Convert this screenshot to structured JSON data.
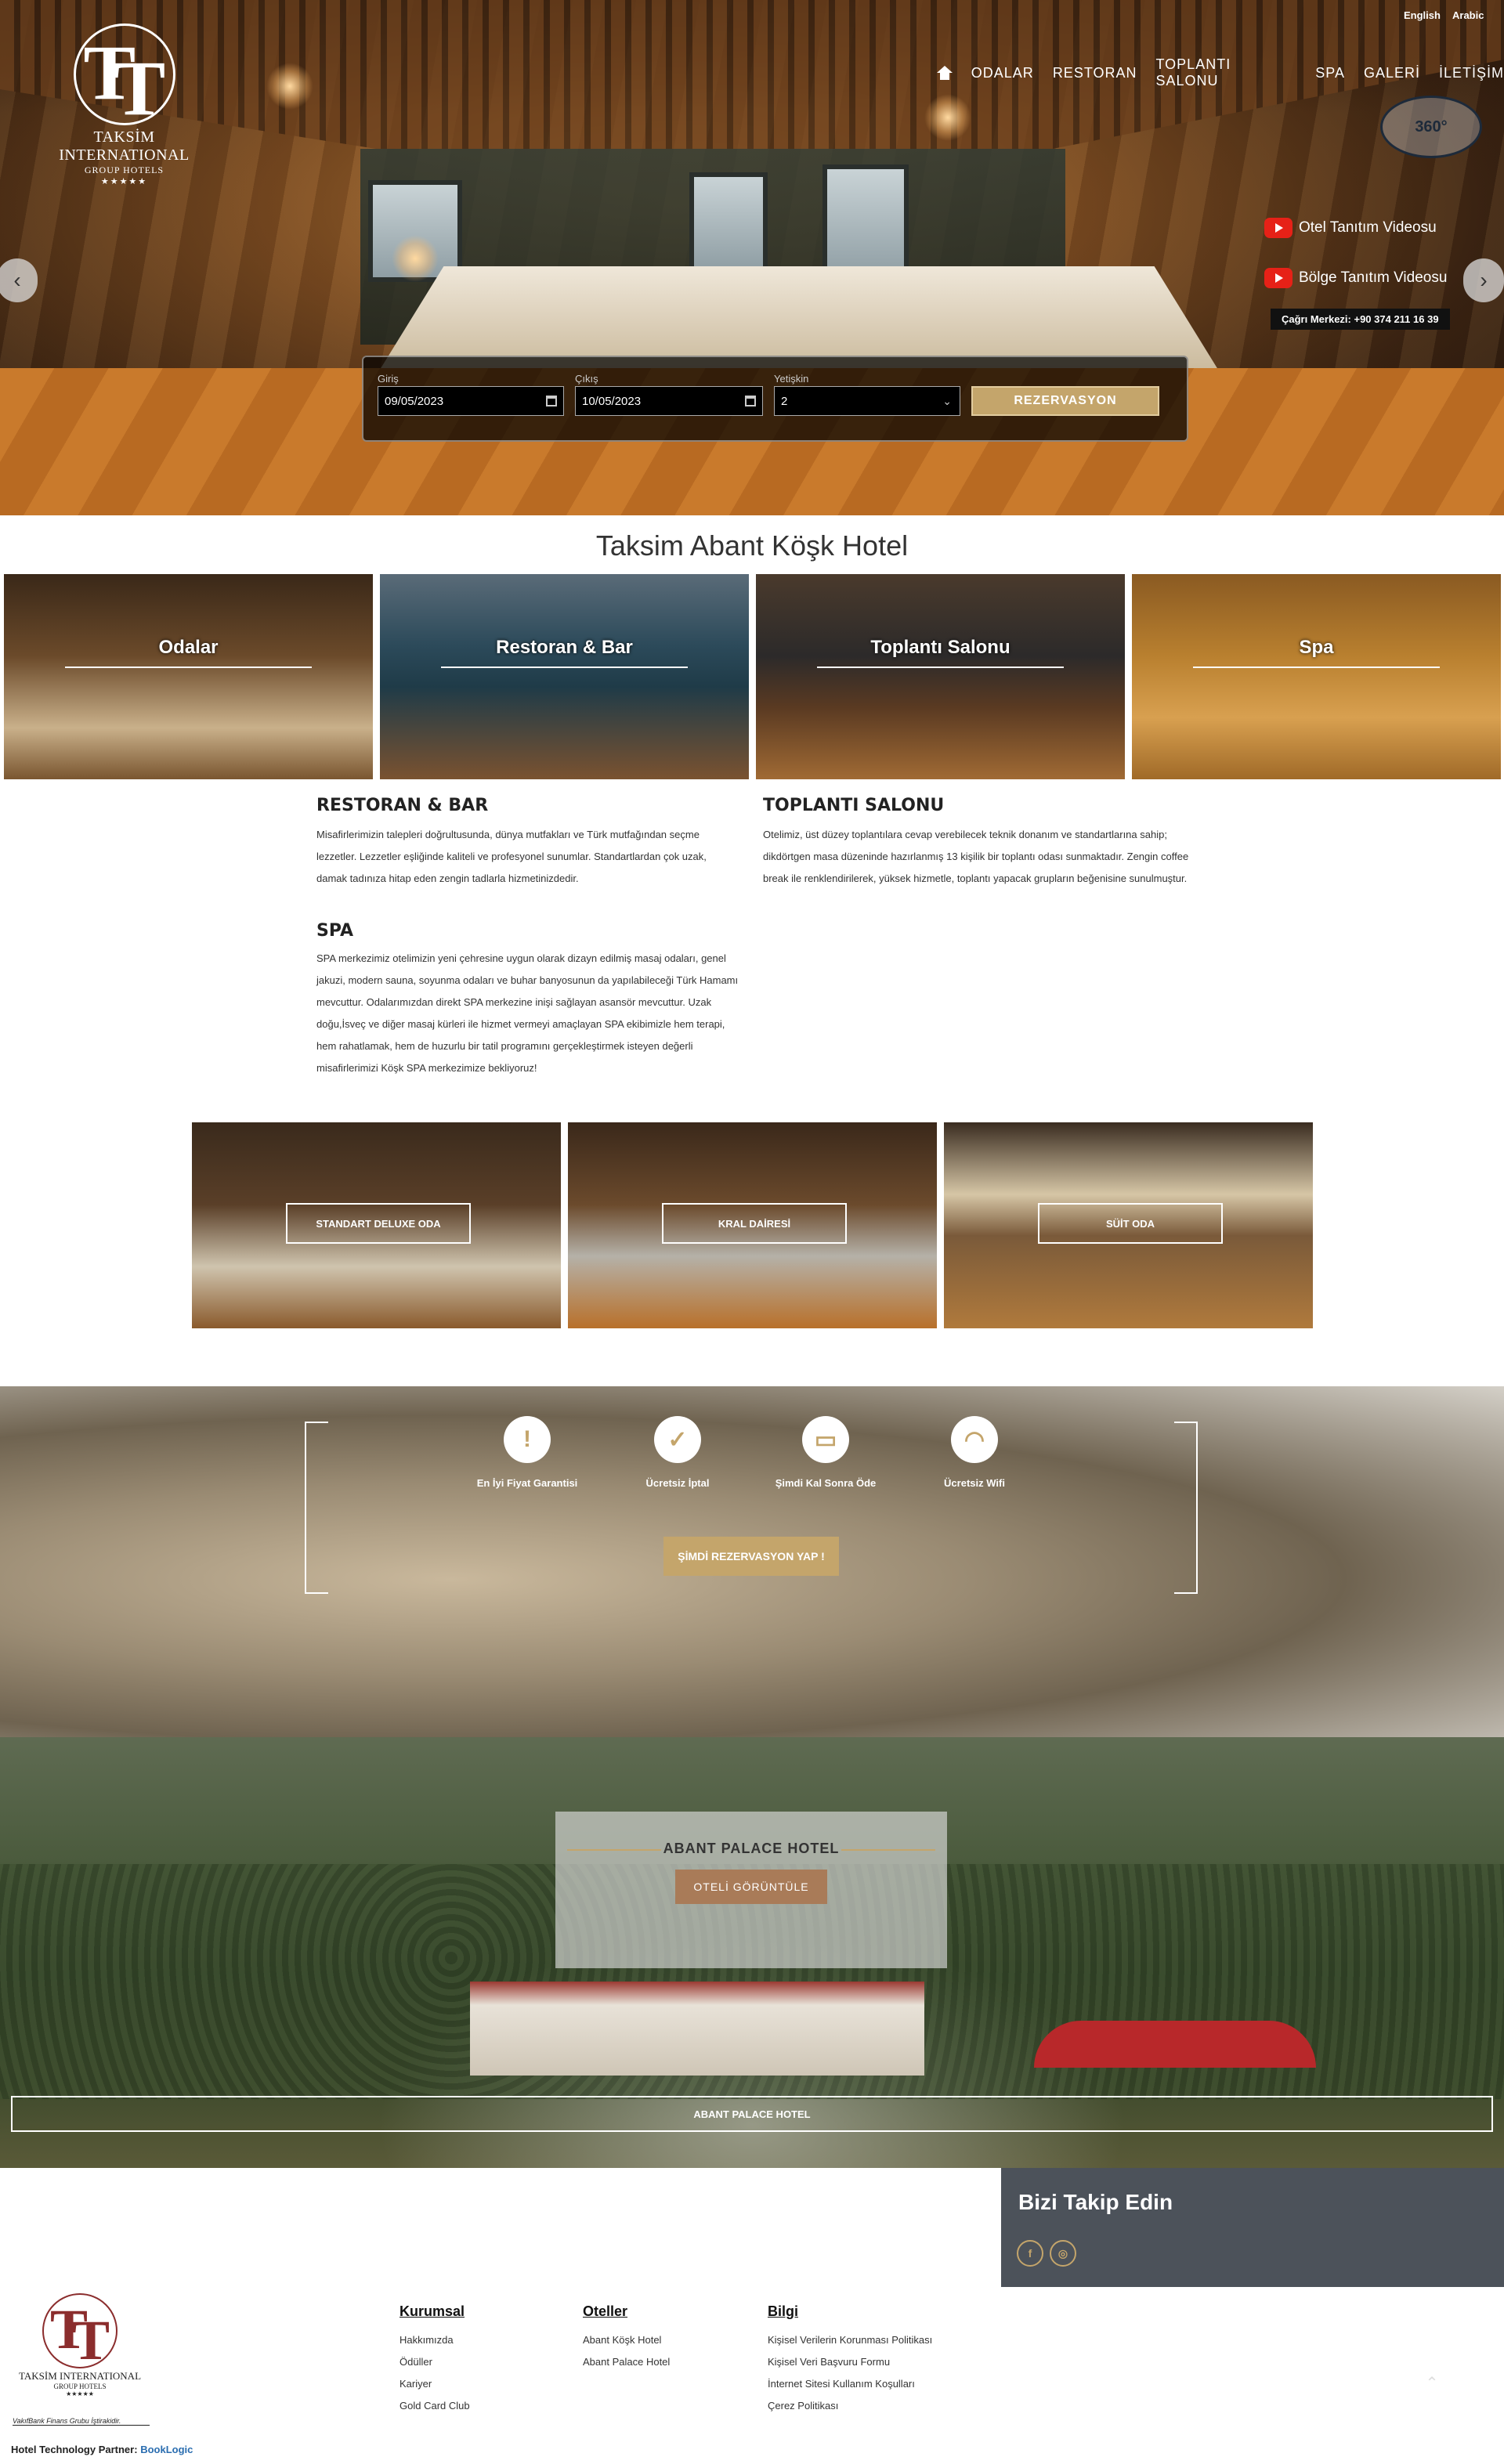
{
  "logo": {
    "name": "TAKSİM INTERNATIONAL",
    "sub": "GROUP HOTELS",
    "stars": "★★★★★"
  },
  "header": {
    "lang_en": "English",
    "lang_ar": "Arabic",
    "nav": [
      "ODALAR",
      "RESTORAN",
      "TOPLANTI SALONU",
      "SPA",
      "GALERİ",
      "İLETİŞİM"
    ],
    "badge_360": "360°",
    "video1": "Otel Tanıtım Videosu",
    "video2": "Bölge Tanıtım Videosu",
    "call_center": "Çağrı Merkezi: +90 374 211 16 39"
  },
  "booking": {
    "checkin_label": "Giriş",
    "checkin_value": "09/05/2023",
    "checkout_label": "Çıkış",
    "checkout_value": "10/05/2023",
    "adults_label": "Yetişkin",
    "adults_value": "2",
    "submit": "REZERVASYON"
  },
  "main": {
    "title": "Taksim Abant Köşk Hotel",
    "tiles": [
      "Odalar",
      "Restoran & Bar",
      "Toplantı Salonu",
      "Spa"
    ]
  },
  "sections": {
    "restoran_title": "RESTORAN & BAR",
    "restoran_text": "Misafirlerimizin talepleri doğrultusunda, dünya mutfakları ve Türk mutfağından seçme lezzetler. Lezzetler eşliğinde kaliteli ve profesyonel sunumlar. Standartlardan çok uzak, damak tadınıza hitap eden zengin tadlarla hizmetinizdedir.",
    "toplanti_title": "TOPLANTI SALONU",
    "toplanti_text": "Otelimiz, üst düzey toplantılara cevap verebilecek teknik donanım ve standartlarına sahip; dikdörtgen masa düzeninde hazırlanmış 13 kişilik bir toplantı odası sunmaktadır. Zengin coffee break ile renklendirilerek, yüksek hizmetle, toplantı yapacak grupların beğenisine sunulmuştur.",
    "spa_title": "SPA",
    "spa_text": "SPA merkezimiz otelimizin yeni çehresine uygun olarak dizayn edilmiş masaj odaları, genel jakuzi, modern sauna, soyunma odaları ve buhar banyosunun da yapılabileceği Türk Hamamı mevcuttur. Odalarımızdan direkt SPA merkezine inişi sağlayan asansör mevcuttur. Uzak doğu,İsveç ve diğer masaj kürleri ile hizmet vermeyi amaçlayan SPA ekibimizle hem terapi, hem rahatlamak, hem de huzurlu bir tatil programını gerçekleştirmek isteyen değerli misafirlerimizi Köşk SPA merkezimize bekliyoruz!"
  },
  "rooms": [
    "STANDART DELUXE ODA",
    "KRAL DAİRESİ",
    "SÜİT ODA"
  ],
  "amenities": {
    "items": [
      {
        "icon": "exclamation-icon",
        "glyph": "!",
        "label": "En İyi Fiyat Garantisi"
      },
      {
        "icon": "check-icon",
        "glyph": "✓",
        "label": "Ücretsiz İptal"
      },
      {
        "icon": "credit-card-icon",
        "glyph": "▭",
        "label": "Şimdi Kal Sonra Öde"
      },
      {
        "icon": "wifi-icon",
        "glyph": "◠",
        "label": "Ücretsiz Wifi"
      }
    ],
    "cta": "ŞİMDİ REZERVASYON YAP !"
  },
  "palace": {
    "title": "ABANT PALACE HOTEL",
    "button": "OTELİ GÖRÜNTÜLE",
    "bar": "ABANT PALACE HOTEL"
  },
  "footer": {
    "follow": "Bizi Takip Edin",
    "social": [
      {
        "icon": "facebook-icon",
        "glyph": "f"
      },
      {
        "icon": "instagram-icon",
        "glyph": "◎"
      }
    ],
    "col1_title": "Kurumsal",
    "col1": [
      "Hakkımızda",
      "Ödüller",
      "Kariyer",
      "Gold Card Club"
    ],
    "col2_title": "Oteller",
    "col2": [
      "Abant Köşk Hotel",
      "Abant Palace Hotel"
    ],
    "col3_title": "Bilgi",
    "col3": [
      "Kişisel Verilerin Korunması Politikası",
      "Kişisel Veri Başvuru Formu",
      "İnternet Sitesi Kullanım Koşulları",
      "Çerez Politikası"
    ],
    "vakif": "VakıfBank Finans Grubu İştirakidir.",
    "partner_label": "Hotel Technology Partner:",
    "partner_name": "BookLogic"
  },
  "colors": {
    "gold": "#c4a56b",
    "footer_panel": "#4c525a",
    "youtube": "#e62117"
  }
}
